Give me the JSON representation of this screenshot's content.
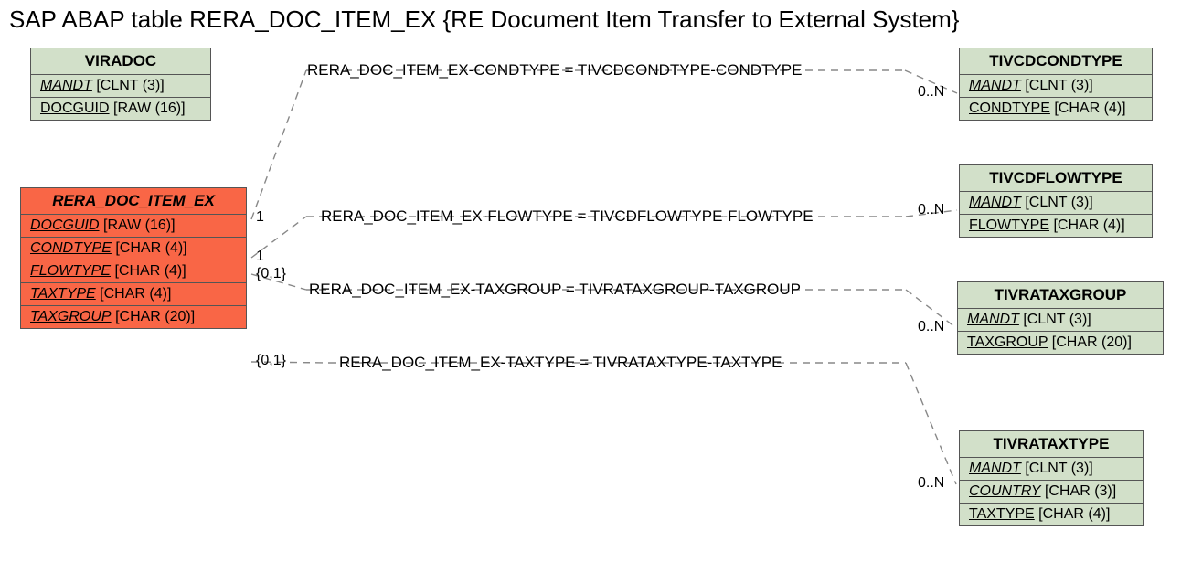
{
  "title": "SAP ABAP table RERA_DOC_ITEM_EX {RE Document Item Transfer to External System}",
  "entities": {
    "viradoc": {
      "name": "VIRADOC",
      "fields": [
        {
          "name": "MANDT",
          "type": "[CLNT (3)]",
          "ital": true
        },
        {
          "name": "DOCGUID",
          "type": "[RAW (16)]",
          "ital": false
        }
      ]
    },
    "main": {
      "name": "RERA_DOC_ITEM_EX",
      "fields": [
        {
          "name": "DOCGUID",
          "type": "[RAW (16)]"
        },
        {
          "name": "CONDTYPE",
          "type": "[CHAR (4)]"
        },
        {
          "name": "FLOWTYPE",
          "type": "[CHAR (4)]"
        },
        {
          "name": "TAXTYPE",
          "type": "[CHAR (4)]"
        },
        {
          "name": "TAXGROUP",
          "type": "[CHAR (20)]"
        }
      ]
    },
    "condtype": {
      "name": "TIVCDCONDTYPE",
      "fields": [
        {
          "name": "MANDT",
          "type": "[CLNT (3)]",
          "ital": true
        },
        {
          "name": "CONDTYPE",
          "type": "[CHAR (4)]",
          "ital": false
        }
      ]
    },
    "flowtype": {
      "name": "TIVCDFLOWTYPE",
      "fields": [
        {
          "name": "MANDT",
          "type": "[CLNT (3)]",
          "ital": true
        },
        {
          "name": "FLOWTYPE",
          "type": "[CHAR (4)]",
          "ital": false
        }
      ]
    },
    "taxgroup": {
      "name": "TIVRATAXGROUP",
      "fields": [
        {
          "name": "MANDT",
          "type": "[CLNT (3)]",
          "ital": true
        },
        {
          "name": "TAXGROUP",
          "type": "[CHAR (20)]",
          "ital": false
        }
      ]
    },
    "taxtype": {
      "name": "TIVRATAXTYPE",
      "fields": [
        {
          "name": "MANDT",
          "type": "[CLNT (3)]",
          "ital": true
        },
        {
          "name": "COUNTRY",
          "type": "[CHAR (3)]",
          "ital": true
        },
        {
          "name": "TAXTYPE",
          "type": "[CHAR (4)]",
          "ital": false
        }
      ]
    }
  },
  "relations": {
    "r1": "RERA_DOC_ITEM_EX-CONDTYPE = TIVCDCONDTYPE-CONDTYPE",
    "r2": "RERA_DOC_ITEM_EX-FLOWTYPE = TIVCDFLOWTYPE-FLOWTYPE",
    "r3": "RERA_DOC_ITEM_EX-TAXGROUP = TIVRATAXGROUP-TAXGROUP",
    "r4": "RERA_DOC_ITEM_EX-TAXTYPE = TIVRATAXTYPE-TAXTYPE"
  },
  "cards": {
    "l1": "1",
    "l2": "1",
    "l3": "{0,1}",
    "l4": "{0,1}",
    "rn": "0..N"
  }
}
